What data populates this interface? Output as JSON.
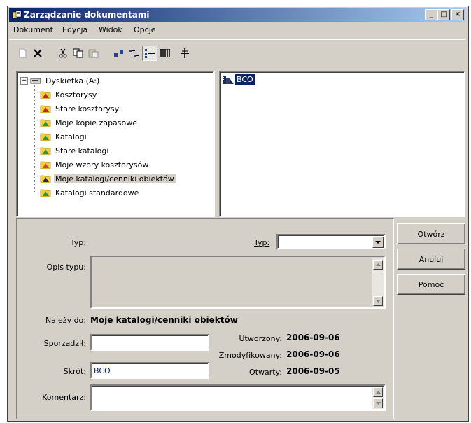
{
  "window": {
    "title": "Zarządzanie dokumentami"
  },
  "menu": [
    "Dokument",
    "Edycja",
    "Widok",
    "Opcje"
  ],
  "tree": {
    "items": [
      {
        "label": "Dyskietka (A:)",
        "icon": "floppy-drive-icon"
      },
      {
        "label": "Kosztorysy",
        "icon": "folder-red-icon"
      },
      {
        "label": "Stare kosztorysy",
        "icon": "folder-red-icon"
      },
      {
        "label": "Moje kopie zapasowe",
        "icon": "folder-green-icon"
      },
      {
        "label": "Katalogi",
        "icon": "folder-green-icon"
      },
      {
        "label": "Stare katalogi",
        "icon": "folder-green-icon"
      },
      {
        "label": "Moje wzory kosztorysów",
        "icon": "folder-template-icon"
      },
      {
        "label": "Moje katalogi/cenniki obiektów",
        "icon": "folder-building-icon"
      },
      {
        "label": "Katalogi standardowe",
        "icon": "folder-green-icon"
      }
    ],
    "selected_index": 7
  },
  "filelist": {
    "items": [
      {
        "label": "BCO",
        "icon": "building-icon"
      }
    ]
  },
  "buttons": {
    "open": "Otwórz",
    "cancel": "Anuluj",
    "help": "Pomoc"
  },
  "form": {
    "typ_label": "Typ:",
    "typ_combo_label": "Typ:",
    "typ_value": "",
    "opis_label": "Opis typu:",
    "nalezy_label": "Należy do:",
    "nalezy_value": "Moje katalogi/cenniki obiektów",
    "sporzadzil_label": "Sporządził:",
    "sporzadzil_value": "",
    "skrot_label": "Skrót:",
    "skrot_value": "BCO",
    "komentarz_label": "Komentarz:",
    "komentarz_value": "",
    "utworzony_label": "Utworzony:",
    "utworzony_value": "2006-09-06",
    "zmodyfikowany_label": "Zmodyfikowany:",
    "zmodyfikowany_value": "2006-09-06",
    "otwarty_label": "Otwarty:",
    "otwarty_value": "2006-09-05"
  }
}
